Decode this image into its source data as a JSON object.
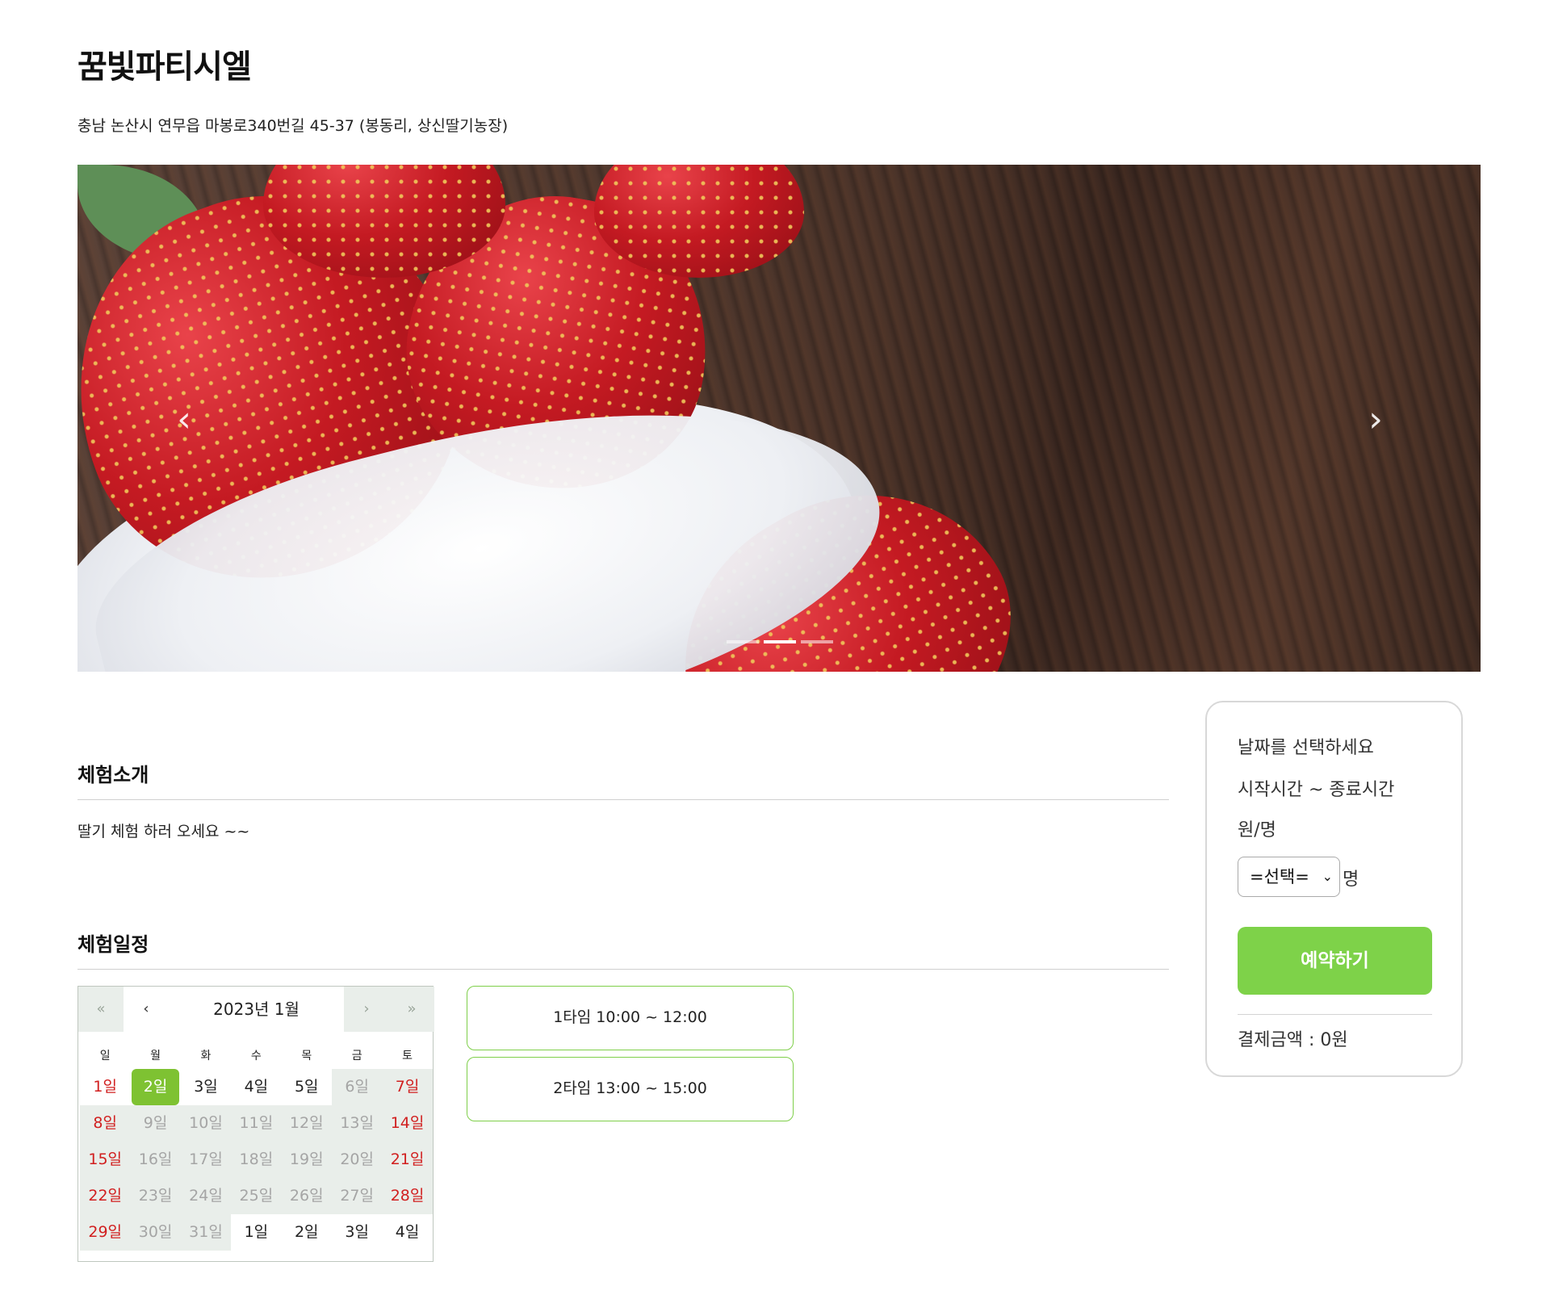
{
  "header": {
    "title": "꿈빛파티시엘",
    "address": "충남 논산시 연무읍 마봉로340번길 45-37 (봉동리, 상신딸기농장)"
  },
  "slider": {
    "prev_icon": "chevron-left-icon",
    "next_icon": "chevron-right-icon",
    "prev_glyph": "‹",
    "next_glyph": "›",
    "slide_count": 3,
    "active_slide": 2
  },
  "intro": {
    "title": "체험소개",
    "text": "딸기 체험 하러 오세요 ~~"
  },
  "schedule": {
    "title": "체험일정",
    "calendar": {
      "month_label": "2023년 1월",
      "nav": {
        "first": "«",
        "prev": "‹",
        "next": "›",
        "last": "»"
      },
      "weekdays": [
        "일",
        "월",
        "화",
        "수",
        "목",
        "금",
        "토"
      ],
      "weeks": [
        [
          {
            "label": "1일",
            "style": "sun"
          },
          {
            "label": "2일",
            "style": "sel"
          },
          {
            "label": "3일",
            "style": "normal"
          },
          {
            "label": "4일",
            "style": "normal"
          },
          {
            "label": "5일",
            "style": "normal"
          },
          {
            "label": "6일",
            "style": "muted"
          },
          {
            "label": "7일",
            "style": "sat"
          }
        ],
        [
          {
            "label": "8일",
            "style": "sun"
          },
          {
            "label": "9일",
            "style": "muted"
          },
          {
            "label": "10일",
            "style": "muted"
          },
          {
            "label": "11일",
            "style": "muted"
          },
          {
            "label": "12일",
            "style": "muted"
          },
          {
            "label": "13일",
            "style": "muted"
          },
          {
            "label": "14일",
            "style": "sat"
          }
        ],
        [
          {
            "label": "15일",
            "style": "sun"
          },
          {
            "label": "16일",
            "style": "muted"
          },
          {
            "label": "17일",
            "style": "muted"
          },
          {
            "label": "18일",
            "style": "muted"
          },
          {
            "label": "19일",
            "style": "muted"
          },
          {
            "label": "20일",
            "style": "muted"
          },
          {
            "label": "21일",
            "style": "sat"
          }
        ],
        [
          {
            "label": "22일",
            "style": "sun"
          },
          {
            "label": "23일",
            "style": "muted"
          },
          {
            "label": "24일",
            "style": "muted"
          },
          {
            "label": "25일",
            "style": "muted"
          },
          {
            "label": "26일",
            "style": "muted"
          },
          {
            "label": "27일",
            "style": "muted"
          },
          {
            "label": "28일",
            "style": "sat"
          }
        ],
        [
          {
            "label": "29일",
            "style": "sun"
          },
          {
            "label": "30일",
            "style": "muted"
          },
          {
            "label": "31일",
            "style": "muted"
          },
          {
            "label": "1일",
            "style": "normal"
          },
          {
            "label": "2일",
            "style": "normal"
          },
          {
            "label": "3일",
            "style": "normal"
          },
          {
            "label": "4일",
            "style": "normal"
          }
        ]
      ]
    },
    "time_slots": [
      {
        "label": "1타임 10:00 ~ 12:00"
      },
      {
        "label": "2타임 13:00 ~ 15:00"
      }
    ]
  },
  "booking": {
    "date_prompt": "날짜를 선택하세요",
    "time_range": "시작시간 ~ 종료시간",
    "price_per_person": "원/명",
    "count_select": "=선택=",
    "count_unit": "명",
    "reserve_button": "예약하기",
    "total_label": "결제금액 : 0원"
  },
  "colors": {
    "accent_green": "#7ed249",
    "selected_day": "#7ec232",
    "weekend_red": "#d11f1f"
  }
}
